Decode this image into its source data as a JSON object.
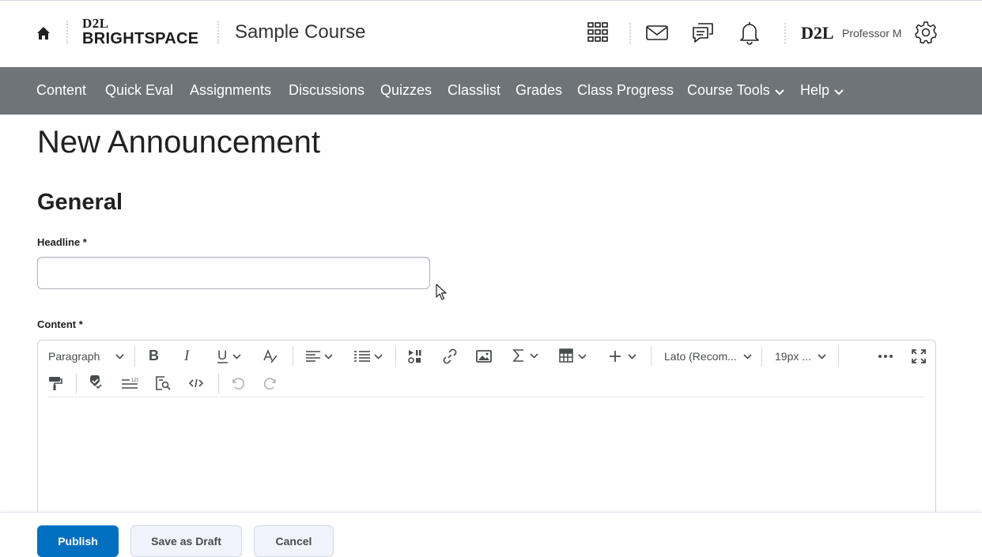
{
  "header": {
    "logo_top": "D2L",
    "logo_bottom": "BRIGHTSPACE",
    "course_title": "Sample Course",
    "brand_small": "D2L",
    "user_name": "Professor M"
  },
  "nav": {
    "items": [
      "Content",
      "Quick Eval",
      "Assignments",
      "Discussions",
      "Quizzes",
      "Classlist",
      "Grades",
      "Class Progress",
      "Course Tools",
      "Help"
    ]
  },
  "page": {
    "title": "New Announcement",
    "section": "General",
    "headline_label": "Headline *",
    "headline_value": "",
    "content_label": "Content *"
  },
  "editor": {
    "block_format": "Paragraph",
    "font_family": "Lato (Recom...",
    "font_size": "19px ..."
  },
  "footer": {
    "publish": "Publish",
    "save_draft": "Save as Draft",
    "cancel": "Cancel"
  },
  "colors": {
    "nav_bg": "#6e7477",
    "primary": "#006fbf"
  }
}
